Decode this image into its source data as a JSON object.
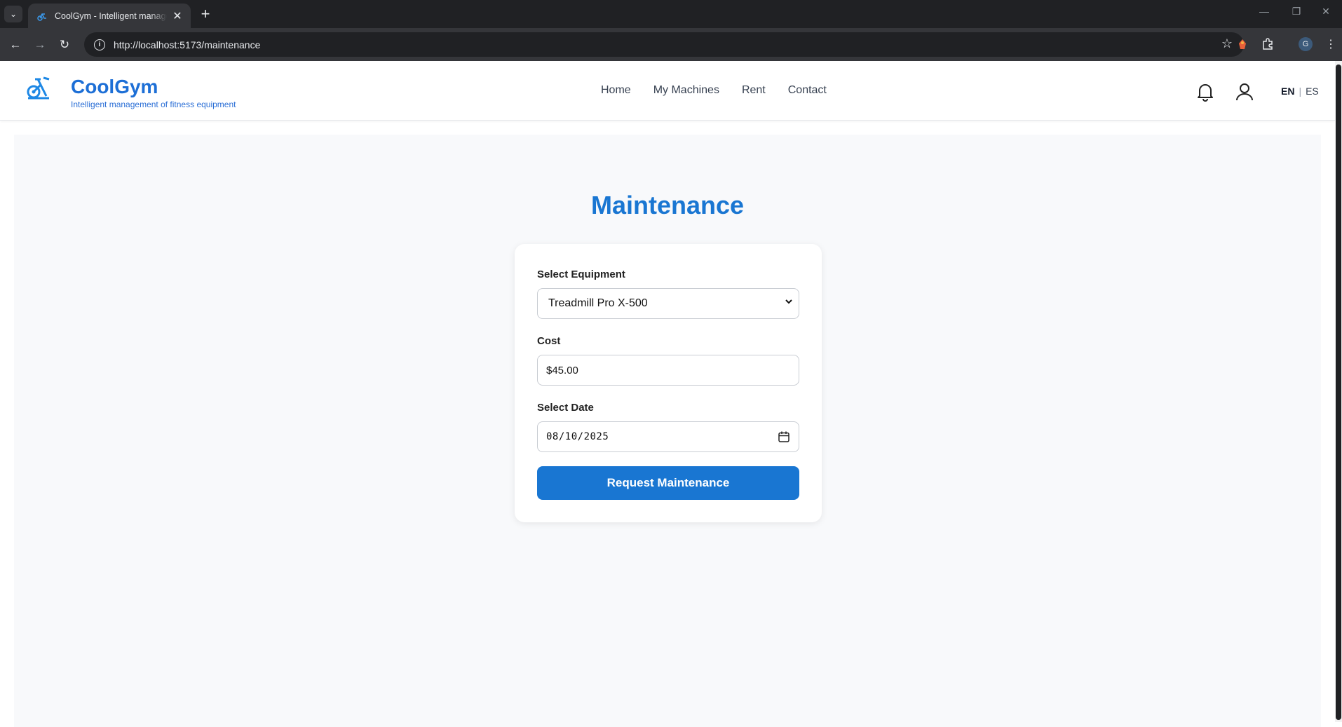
{
  "browser": {
    "tab_title": "CoolGym - Intelligent management of fitness equipment",
    "url": "http://localhost:5173/maintenance",
    "profile_initial": "G"
  },
  "header": {
    "brand": "CoolGym",
    "tagline": "Intelligent management of fitness equipment",
    "nav": [
      "Home",
      "My Machines",
      "Rent",
      "Contact"
    ],
    "lang_en": "EN",
    "lang_sep": "|",
    "lang_es": "ES"
  },
  "main": {
    "title": "Maintenance",
    "form": {
      "equipment_label": "Select Equipment",
      "equipment_value": "Treadmill Pro X-500",
      "cost_label": "Cost",
      "cost_value": "$45.00",
      "date_label": "Select Date",
      "date_value": "08/10/2025",
      "submit_label": "Request Maintenance"
    }
  },
  "colors": {
    "accent": "#1976d2",
    "brand": "#1d6fd6"
  },
  "icons": [
    "tab-list-icon",
    "favicon-icon",
    "close-icon",
    "plus-icon",
    "back-icon",
    "forward-icon",
    "reload-icon",
    "info-icon",
    "star-icon",
    "extension-icon",
    "puzzle-icon",
    "menu-icon",
    "bike-logo-icon",
    "bell-icon",
    "user-icon",
    "chevron-down-icon",
    "calendar-icon"
  ]
}
